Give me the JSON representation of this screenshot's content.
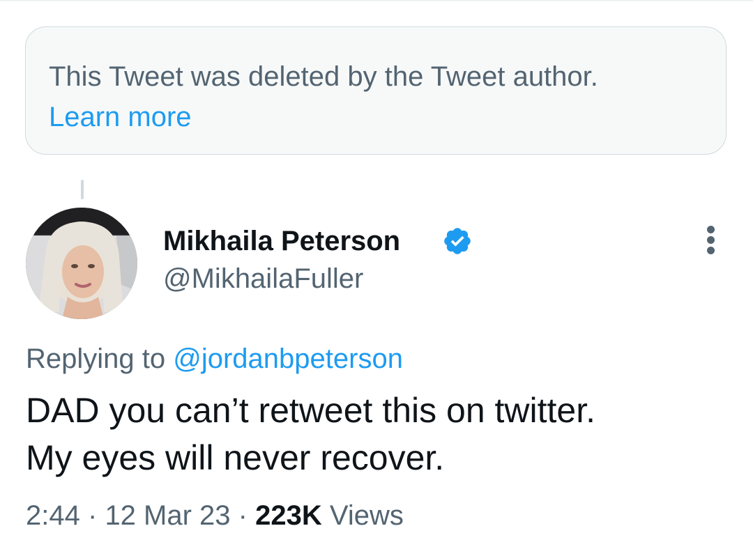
{
  "deleted_notice": {
    "text": "This Tweet was deleted by the Tweet author.",
    "link_label": "Learn more"
  },
  "tweet": {
    "author": {
      "display_name": "Mikhaila Peterson",
      "handle": "@MikhailaFuller",
      "verified_icon": "verified-badge-icon",
      "avatar_alt": "Mikhaila Peterson"
    },
    "replying_prefix": "Replying to",
    "replying_to": "@jordanbpeterson",
    "text_lines": [
      "DAD you can’t retweet this on twitter.",
      "My eyes will never recover."
    ],
    "time": "2:44",
    "separator": "·",
    "date": "12 Mar 23",
    "views_count": "223K",
    "views_label": "Views",
    "more_icon": "more-vertical-icon"
  },
  "colors": {
    "accent": "#1d9bf0",
    "secondary_text": "#536471",
    "primary_text": "#0f1419",
    "notice_background": "#f7f9f9",
    "border": "#cfd9de"
  }
}
